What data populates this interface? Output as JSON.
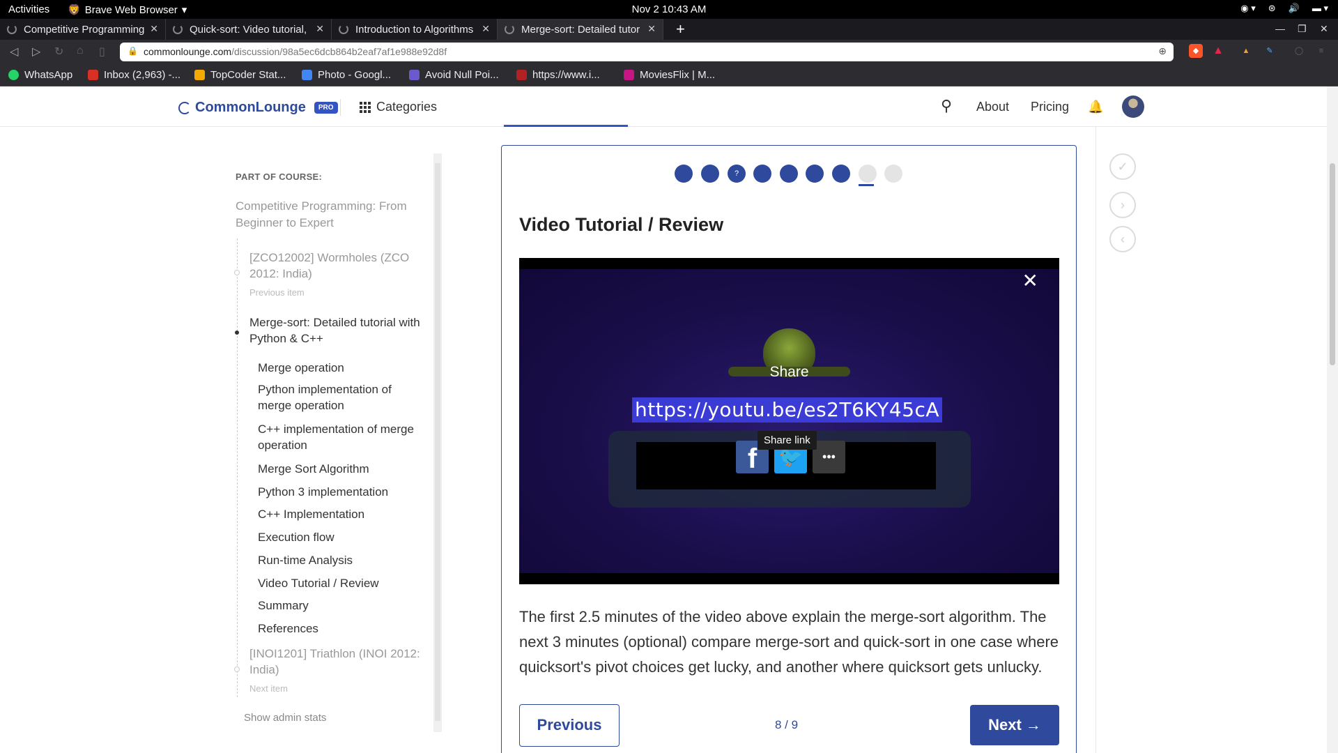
{
  "system": {
    "activities": "Activities",
    "app_name": "Brave Web Browser",
    "clock": "Nov 2  10:43 AM"
  },
  "browser": {
    "tabs": [
      {
        "label": "Competitive Programming"
      },
      {
        "label": "Quick-sort: Video tutorial,"
      },
      {
        "label": "Introduction to Algorithms"
      },
      {
        "label": "Merge-sort: Detailed tutor"
      }
    ],
    "url_domain": "commonlounge.com",
    "url_path": "/discussion/98a5ec6dcb864b2eaf7af1e988e92d8f",
    "bookmarks": [
      {
        "label": "WhatsApp",
        "color": "#25d366"
      },
      {
        "label": "Inbox (2,963) -...",
        "color": "#d93025"
      },
      {
        "label": "TopCoder Stat...",
        "color": "#f2a900"
      },
      {
        "label": "Photo - Googl...",
        "color": "#4285f4"
      },
      {
        "label": "Avoid Null Poi...",
        "color": "#6a5acd"
      },
      {
        "label": "https://www.i...",
        "color": "#b22222"
      },
      {
        "label": "MoviesFlix | M...",
        "color": "#c71585"
      }
    ]
  },
  "site": {
    "logo": "CommonLounge",
    "pro_badge": "PRO",
    "categories": "Categories",
    "about": "About",
    "pricing": "Pricing"
  },
  "sidebar": {
    "part_of_course": "PART OF COURSE:",
    "course_name": "Competitive Programming: From Beginner to Expert",
    "previous_item": "[ZCO12002] Wormholes (ZCO 2012: India)",
    "previous_label": "Previous item",
    "current_item": "Merge-sort: Detailed tutorial with Python & C++",
    "toc": [
      "Merge operation",
      "Python implementation of merge operation",
      "C++ implementation of merge operation",
      "Merge Sort Algorithm",
      "Python 3 implementation",
      "C++ Implementation",
      "Execution flow",
      "Run-time Analysis",
      "Video Tutorial / Review",
      "Summary",
      "References"
    ],
    "next_item": "[INOI1201] Triathlon (INOI 2012: India)",
    "next_label": "Next item",
    "admin_link": "Show admin stats"
  },
  "main": {
    "progress_total": 9,
    "progress_current": 8,
    "progress_quiz_marker": "?",
    "title": "Video Tutorial / Review",
    "video": {
      "share_title": "Share",
      "share_url": "https://youtu.be/es2T6KY45cA",
      "tooltip": "Share link",
      "more": "•••"
    },
    "body": "The first 2.5 minutes of the video above explain the merge-sort algorithm. The next 3 minutes (optional) compare merge-sort and quick-sort in one case where quicksort's pivot choices get lucky, and another where quicksort gets unlucky.",
    "previous_button": "Previous",
    "pager": "8 / 9",
    "next_button": "Next →"
  },
  "colors": {
    "accent": "#2f4a9c"
  }
}
